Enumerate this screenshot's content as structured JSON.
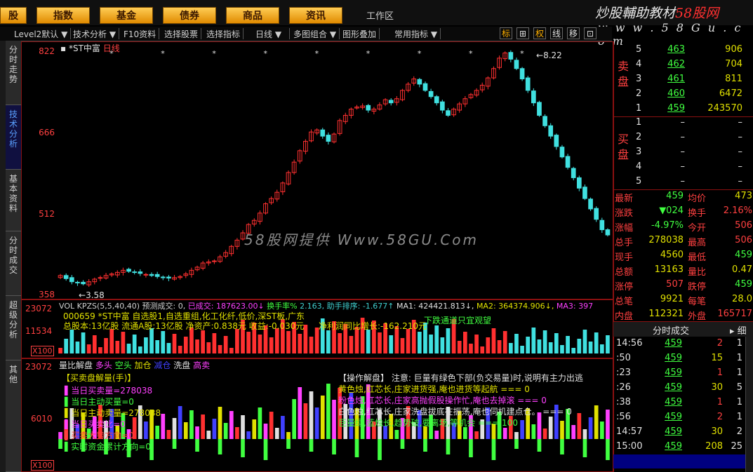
{
  "menu": {
    "items": [
      "股",
      "指数",
      "基金",
      "债券",
      "商品",
      "资讯"
    ],
    "workarea": "工作区",
    "brand_a": "炒股輔助教材",
    "brand_b": "58股网",
    "brand_url": "w w w . 5 8 G u . c o m"
  },
  "toolbar": {
    "items": [
      "Level2默认",
      "技术分析",
      "F10资料",
      "选择股票",
      "选择指标",
      "日线",
      "多图组合",
      "图形叠加",
      "常用指标"
    ],
    "icons": [
      "标",
      "⊞",
      "权",
      "线",
      "移",
      "⊡"
    ]
  },
  "left_tabs": [
    "分时走势",
    "技术分析",
    "基本资料",
    "分时成交",
    "超级分析",
    "其他"
  ],
  "stock": {
    "title": "*ST中富",
    "period": "日线",
    "code": "000659",
    "info_line1": "000659 *ST中富  自选股1,自选重组,化工化纤,低价,深ST板,广东",
    "info_line2": "总股本:13亿股  流通A股:13亿股  净资产:0.838元  收益:-0.030元",
    "info_line3": "净利润同比增长:-162.210元",
    "info_right": "下跌通道只宜观望"
  },
  "price_axis": [
    "822",
    "666",
    "512",
    "358"
  ],
  "price_marks": {
    "high": "8.22",
    "low": "3.58"
  },
  "watermark": "58股网提供  Www.58GU.Com",
  "vol_header": {
    "a": "VOL KPZS(5,5,40,40)",
    "b": "预测成交: 0,",
    "c": "已成交: 187623.00↓",
    "d": "换手率%",
    "e": "2.163,",
    "f": "助手排序:",
    "g": "-1.677↑",
    "h": "MA1: 424421.813↓,",
    "i": "MA2: 364374.906↓,",
    "j": "MA3: 397"
  },
  "vol_axis": [
    "23072",
    "11534",
    "X100"
  ],
  "lower_axis": [
    "23072",
    "6010",
    "X100"
  ],
  "lower_header": {
    "a": "量比解盘",
    "b": "多头",
    "c": "空头",
    "d": "加仓",
    "e": "减仓",
    "f": "洗盘",
    "g": "高卖"
  },
  "lower_left": {
    "title": "【买卖盘解量(手)】",
    "l1": "当日买卖量=278038",
    "l2": "当日主动买量=0",
    "l3": "当日主动卖量=278038",
    "l4": "当日买卖比=0",
    "l5": "买卖大势方向=0",
    "l6": "实时资金累计方向=0"
  },
  "lower_right": {
    "title": "【操作解盘】 注意: 巨量有绿色下部(负交易量)时,说明有主力出逃",
    "l1": "黄色烛,红芯长,庄家进货强,庵也进货等起航  === 0",
    "l2": "粉色烛,红芯长,庄家高抛假股操作忙,庵也去掉滚  === 0",
    "l3": "白色烛,红芯长,庄家洗盘拔底在振荡,庵也伺机建点仓。  === 0",
    "l4": "巨量绿,蓝烛长,趋势破,要离场,等机会  === 100"
  },
  "orderbook": {
    "sell_label": [
      "卖",
      "盘"
    ],
    "buy_label": [
      "买",
      "盘"
    ],
    "sell": [
      {
        "lvl": "5",
        "price": "463",
        "vol": "906"
      },
      {
        "lvl": "4",
        "price": "462",
        "vol": "704"
      },
      {
        "lvl": "3",
        "price": "461",
        "vol": "811"
      },
      {
        "lvl": "2",
        "price": "460",
        "vol": "6472"
      },
      {
        "lvl": "1",
        "price": "459",
        "vol": "243570"
      }
    ],
    "buy": [
      {
        "lvl": "1",
        "price": "–",
        "vol": "–"
      },
      {
        "lvl": "2",
        "price": "–",
        "vol": "–"
      },
      {
        "lvl": "3",
        "price": "–",
        "vol": "–"
      },
      {
        "lvl": "4",
        "price": "–",
        "vol": "–"
      },
      {
        "lvl": "5",
        "price": "–",
        "vol": "–"
      }
    ]
  },
  "quote": [
    {
      "k1": "最新",
      "v1": "459",
      "k2": "均价",
      "v2": "473"
    },
    {
      "k1": "涨跌",
      "v1": "▼024",
      "k2": "换手",
      "v2": "2.16%"
    },
    {
      "k1": "涨幅",
      "v1": "-4.97%",
      "k2": "今开",
      "v2": "506"
    },
    {
      "k1": "总手",
      "v1": "278038",
      "k2": "最高",
      "v2": "506"
    },
    {
      "k1": "现手",
      "v1": "4560",
      "k2": "最低",
      "v2": "459"
    },
    {
      "k1": "总额",
      "v1": "13163",
      "k2": "量比",
      "v2": "0.47"
    },
    {
      "k1": "涨停",
      "v1": "507",
      "k2": "跌停",
      "v2": "459"
    },
    {
      "k1": "总笔",
      "v1": "9921",
      "k2": "每笔",
      "v2": "28.0"
    },
    {
      "k1": "内盘",
      "v1": "112321",
      "k2": "外盘",
      "v2": "165717"
    }
  ],
  "ticks_header": "分时成交",
  "ticks_more": "细",
  "ticks": [
    {
      "t": "14:56",
      "p": "459",
      "v": "2",
      "n": "1"
    },
    {
      "t": ":50",
      "p": "459",
      "v": "15",
      "n": "1"
    },
    {
      "t": ":23",
      "p": "459",
      "v": "1",
      "n": "1"
    },
    {
      "t": ":26",
      "p": "459",
      "v": "30",
      "n": "5"
    },
    {
      "t": ":38",
      "p": "459",
      "v": "1",
      "n": "1"
    },
    {
      "t": ":56",
      "p": "459",
      "v": "2",
      "n": "1"
    },
    {
      "t": "14:57",
      "p": "459",
      "v": "30",
      "n": "2"
    },
    {
      "t": "15:00",
      "p": "459",
      "v": "208",
      "n": "25"
    },
    {
      "t": ":20",
      "p": "459",
      "v": "",
      "n": ""
    }
  ],
  "chart_data": {
    "type": "candlestick",
    "y_axis_labels": [
      822,
      666,
      512,
      358
    ],
    "ylim": [
      358,
      822
    ],
    "close_series": [
      392,
      386,
      380,
      378,
      376,
      380,
      385,
      388,
      392,
      395,
      398,
      402,
      400,
      398,
      396,
      394,
      392,
      390,
      388,
      387,
      388,
      390,
      395,
      402,
      408,
      416,
      418,
      420,
      428,
      436,
      448,
      460,
      474,
      490,
      498,
      512,
      530,
      540,
      552,
      570,
      590,
      610,
      632,
      650,
      668,
      672,
      660,
      650,
      664,
      690,
      700,
      712,
      716,
      718,
      710,
      712,
      720,
      730,
      724,
      732,
      748,
      760,
      770,
      760,
      748,
      736,
      724,
      710,
      700,
      712,
      722,
      732,
      740,
      748,
      758,
      772,
      790,
      810,
      820,
      808,
      790,
      770,
      748,
      724,
      700,
      680,
      660,
      640,
      620,
      600,
      580,
      560,
      540,
      520,
      500,
      480,
      470
    ]
  }
}
